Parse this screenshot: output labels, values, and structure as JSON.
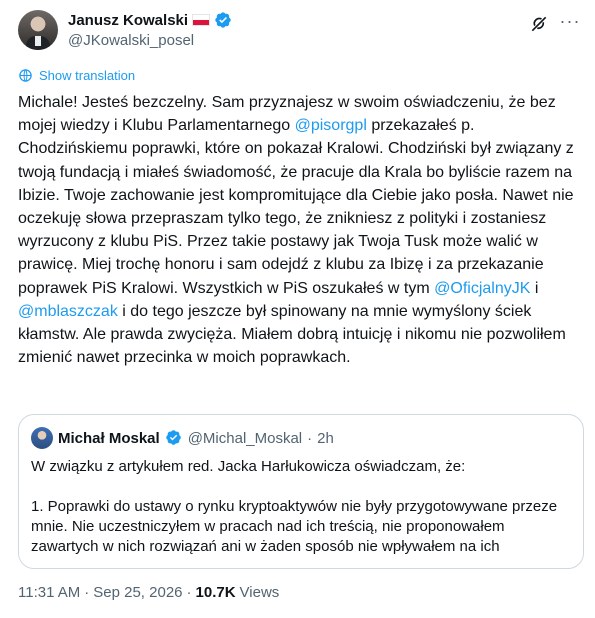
{
  "author": {
    "name": "Janusz Kowalski",
    "handle": "@JKowalski_posel"
  },
  "translate": {
    "label": "Show translation"
  },
  "tweet": {
    "segments": [
      {
        "t": "Michale! Jesteś bezczelny. Sam przyznajesz w swoim oświadczeniu, że bez mojej wiedzy i Klubu Parlamentarnego "
      },
      {
        "t": "@pisorgpl",
        "mention": true
      },
      {
        "t": " przekazałeś p. Chodzińskiemu poprawki, które on pokazał Kralowi. Chodziński był związany z twoją fundacją i miałeś świadomość, że pracuje dla Krala bo byliście razem na Ibizie. Twoje zachowanie jest kompromitujące dla Ciebie jako posła. Nawet nie oczekuję słowa przepraszam tylko tego, że znikniesz z polityki i zostaniesz wyrzucony z klubu PiS. Przez takie postawy jak Twoja Tusk może walić w prawicę. Miej trochę honoru i sam odejdź z klubu za Ibizę i za przekazanie poprawek PiS Kralowi. Wszystkich w PiS oszukałeś w tym "
      },
      {
        "t": "@OficjalnyJK",
        "mention": true
      },
      {
        "t": " i "
      },
      {
        "t": "@mblaszczak",
        "mention": true
      },
      {
        "t": " i do tego jeszcze był spinowany na mnie wymyślony ściek kłamstw. Ale prawda zwycięża. Miałem dobrą intuicję i nikomu nie pozwoliłem zmienić nawet przecinka w moich poprawkach."
      }
    ]
  },
  "quote": {
    "name": "Michał Moskal",
    "handle": "@Michal_Moskal",
    "separator": "·",
    "time": "2h",
    "paragraph1": "W związku z artykułem red. Jacka Harłukowicza oświadczam, że:",
    "paragraph2": "1. Poprawki do ustawy o rynku kryptoaktywów nie były przygotowywane przeze mnie. Nie uczestniczyłem w pracach nad ich treścią, nie proponowałem zawartych w nich rozwiązań ani w żaden sposób nie wpływałem na ich"
  },
  "meta": {
    "time": "11:31 AM",
    "sep1": "·",
    "date": "Sep 25, 2026",
    "sep2": "·",
    "views_count": "10.7K",
    "views_label": "Views"
  },
  "colors": {
    "accent": "#1d9bf0",
    "muted": "#536471",
    "text": "#0f1419",
    "border": "#cfd9de"
  },
  "icons": [
    "verified-badge-icon",
    "poland-flag-icon",
    "grok-icon",
    "more-icon",
    "globe-icon"
  ]
}
